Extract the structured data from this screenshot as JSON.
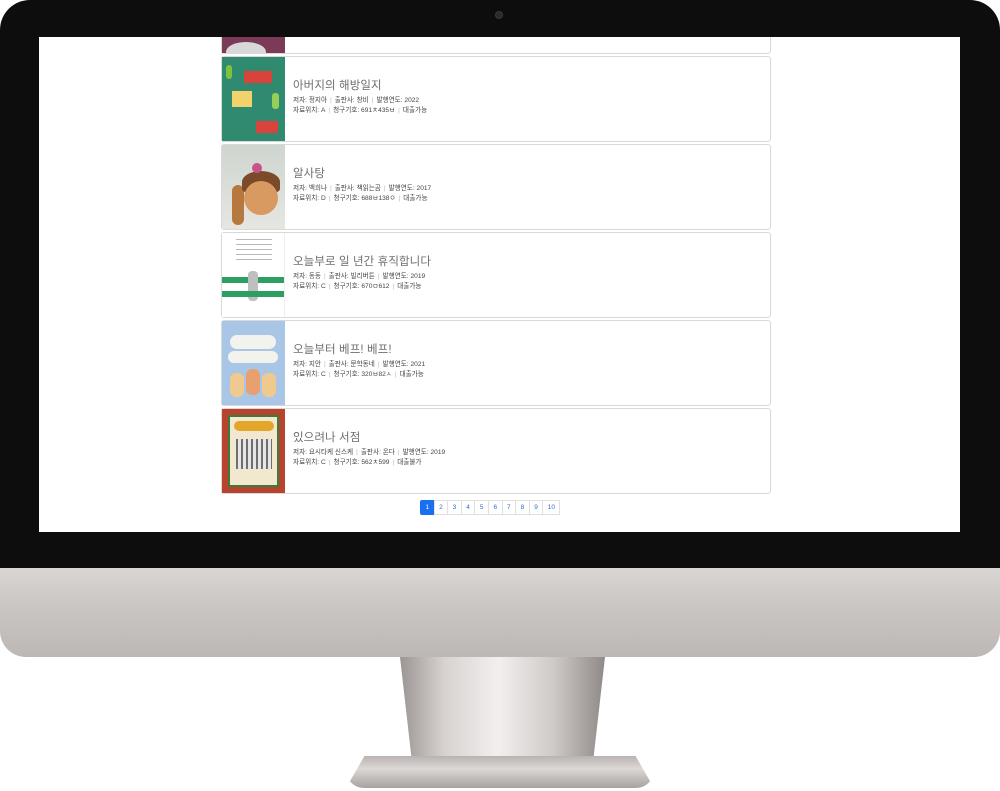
{
  "books": [
    {
      "title": "아버지의 해방일지",
      "author_label": "저자:",
      "author": "정지아",
      "publisher_label": "출판사:",
      "publisher": "창비",
      "year_label": "발행연도:",
      "year": "2022",
      "location_label": "자료위치:",
      "location": "A",
      "callno_label": "청구기호:",
      "callno": "691ㅊ435ㅂ",
      "status": "대출가능"
    },
    {
      "title": "알사탕",
      "author_label": "저자:",
      "author": "백희나",
      "publisher_label": "출판사:",
      "publisher": "책읽는곰",
      "year_label": "발행연도:",
      "year": "2017",
      "location_label": "자료위치:",
      "location": "D",
      "callno_label": "청구기호:",
      "callno": "688ㅂ138ㅇ",
      "status": "대출가능"
    },
    {
      "title": "오늘부로 일 년간 휴직합니다",
      "author_label": "저자:",
      "author": "동동",
      "publisher_label": "출판사:",
      "publisher": "빌리버튼",
      "year_label": "발행연도:",
      "year": "2019",
      "location_label": "자료위치:",
      "location": "C",
      "callno_label": "청구기호:",
      "callno": "670ㅁ612",
      "status": "대출가능"
    },
    {
      "title": "오늘부터 베프! 베프!",
      "author_label": "저자:",
      "author": "지안",
      "publisher_label": "출판사:",
      "publisher": "문학동네",
      "year_label": "발행연도:",
      "year": "2021",
      "location_label": "자료위치:",
      "location": "C",
      "callno_label": "청구기호:",
      "callno": "320ㅂ82ㅅ",
      "status": "대출가능"
    },
    {
      "title": "있으려나 서점",
      "author_label": "저자:",
      "author": "요시타케 신스케",
      "publisher_label": "출판사:",
      "publisher": "온다",
      "year_label": "발행연도:",
      "year": "2019",
      "location_label": "자료위치:",
      "location": "C",
      "callno_label": "청구기호:",
      "callno": "562ㅊ599",
      "status": "대출불가"
    }
  ],
  "pagination": {
    "pages": [
      "1",
      "2",
      "3",
      "4",
      "5",
      "6",
      "7",
      "8",
      "9",
      "10"
    ],
    "current": "1"
  }
}
